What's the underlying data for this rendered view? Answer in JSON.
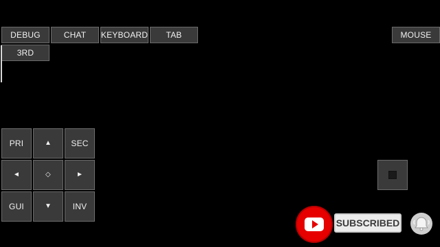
{
  "top_bar": {
    "debug": "DEBUG",
    "chat": "CHAT",
    "keyboard": "KEYBOARD",
    "tab": "TAB",
    "mouse": "MOUSE",
    "third_person": "3RD"
  },
  "dpad": {
    "primary": "PRI",
    "up": "▲",
    "secondary": "SEC",
    "left": "◄",
    "center": "◇",
    "right": "►",
    "gui": "GUI",
    "down": "▼",
    "inventory": "INV"
  },
  "overlay": {
    "subscribe_label": "SUBSCRIBED"
  },
  "icons": {
    "youtube": "youtube-logo-icon",
    "bell": "bell-icon",
    "square": "square-icon"
  },
  "colors": {
    "button_bg": "#3a3a3a",
    "button_border": "#6b6b6b",
    "youtube_red": "#e60000"
  }
}
